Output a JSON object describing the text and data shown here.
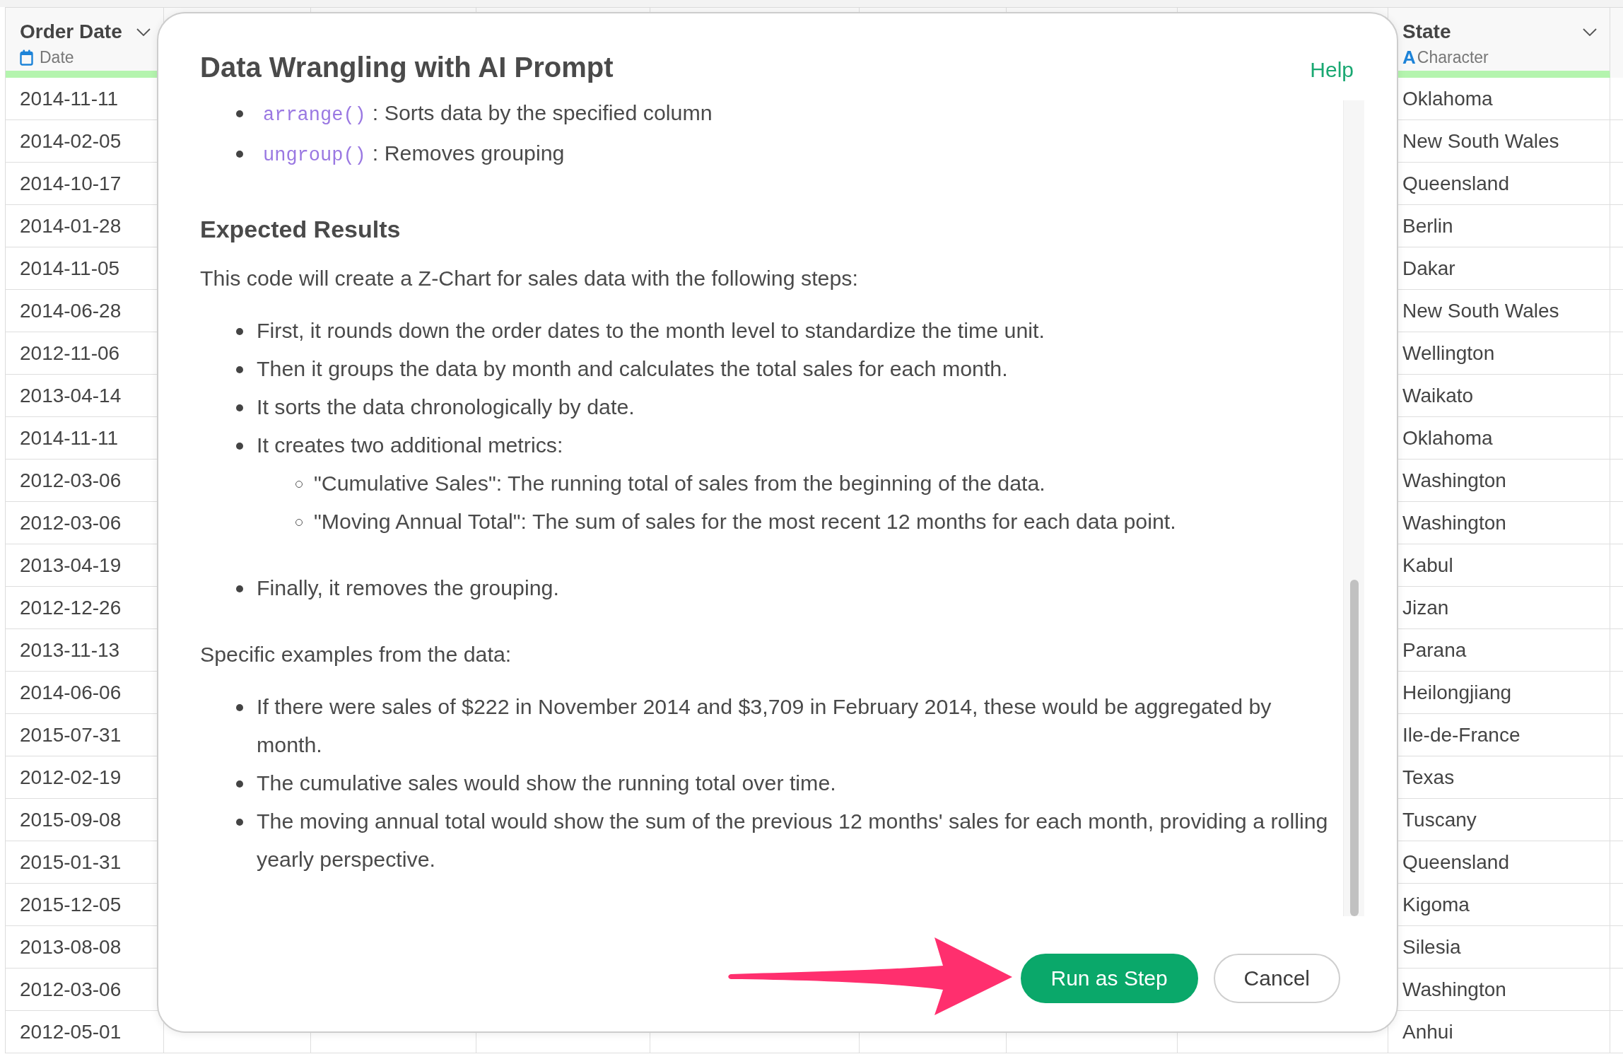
{
  "table": {
    "columns": [
      {
        "name": "Order Date",
        "type": "Date",
        "kind": "date"
      },
      {
        "name": "State",
        "type": "Character",
        "kind": "character",
        "type_glyph": "A"
      }
    ],
    "rows": [
      {
        "order_date": "2014-11-11",
        "state": "Oklahoma"
      },
      {
        "order_date": "2014-02-05",
        "state": "New South Wales"
      },
      {
        "order_date": "2014-10-17",
        "state": "Queensland"
      },
      {
        "order_date": "2014-01-28",
        "state": "Berlin"
      },
      {
        "order_date": "2014-11-05",
        "state": "Dakar"
      },
      {
        "order_date": "2014-06-28",
        "state": "New South Wales"
      },
      {
        "order_date": "2012-11-06",
        "state": "Wellington"
      },
      {
        "order_date": "2013-04-14",
        "state": "Waikato"
      },
      {
        "order_date": "2014-11-11",
        "state": "Oklahoma"
      },
      {
        "order_date": "2012-03-06",
        "state": "Washington"
      },
      {
        "order_date": "2012-03-06",
        "state": "Washington"
      },
      {
        "order_date": "2013-04-19",
        "state": "Kabul"
      },
      {
        "order_date": "2012-12-26",
        "state": "Jizan"
      },
      {
        "order_date": "2013-11-13",
        "state": "Parana"
      },
      {
        "order_date": "2014-06-06",
        "state": "Heilongjiang"
      },
      {
        "order_date": "2015-07-31",
        "state": "Ile-de-France"
      },
      {
        "order_date": "2012-02-19",
        "state": "Texas"
      },
      {
        "order_date": "2015-09-08",
        "state": "Tuscany"
      },
      {
        "order_date": "2015-01-31",
        "state": "Queensland"
      },
      {
        "order_date": "2015-12-05",
        "state": "Kigoma"
      },
      {
        "order_date": "2013-08-08",
        "state": "Silesia"
      },
      {
        "order_date": "2012-03-06",
        "state": "Washington"
      },
      {
        "order_date": "2012-05-01",
        "state": "Anhui"
      }
    ]
  },
  "dialog": {
    "title": "Data Wrangling with AI Prompt",
    "help": "Help",
    "content": [
      {
        "kind": "list",
        "items": [
          {
            "code": "arrange()",
            "text": ": Sorts data by the specified column"
          },
          {
            "code": "ungroup()",
            "text": ": Removes grouping"
          }
        ]
      },
      {
        "kind": "heading",
        "text": "Expected Results"
      },
      {
        "kind": "paragraph",
        "text": "This code will create a Z-Chart for sales data with the following steps:"
      },
      {
        "kind": "list",
        "items": [
          {
            "text": "First, it rounds down the order dates to the month level to standardize the time unit."
          },
          {
            "text": "Then it groups the data by month and calculates the total sales for each month."
          },
          {
            "text": "It sorts the data chronologically by date."
          },
          {
            "text": "It creates two additional metrics:",
            "children": [
              {
                "text": "\"Cumulative Sales\": The running total of sales from the beginning of the data."
              },
              {
                "text": "\"Moving Annual Total\": The sum of sales for the most recent 12 months for each data point."
              }
            ]
          },
          {
            "text": "Finally, it removes the grouping."
          }
        ]
      },
      {
        "kind": "paragraph",
        "text": "Specific examples from the data:"
      },
      {
        "kind": "list",
        "items": [
          {
            "text": "If there were sales of $222 in November 2014 and $3,709 in February 2014, these would be aggregated by month."
          },
          {
            "text": "The cumulative sales would show the running total over time."
          },
          {
            "text": "The moving annual total would show the sum of the previous 12 months' sales for each month, providing a rolling yearly perspective."
          }
        ]
      }
    ],
    "buttons": [
      {
        "label": "Run as Step",
        "kind": "primary"
      },
      {
        "label": "Cancel",
        "kind": "secondary"
      }
    ]
  }
}
